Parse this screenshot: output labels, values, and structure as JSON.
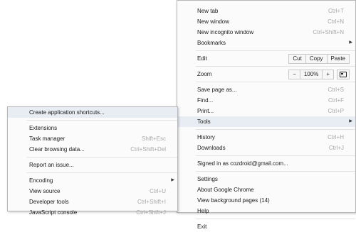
{
  "main_menu": {
    "new_tab": {
      "label": "New tab",
      "shortcut": "Ctrl+T"
    },
    "new_window": {
      "label": "New window",
      "shortcut": "Ctrl+N"
    },
    "new_incognito": {
      "label": "New incognito window",
      "shortcut": "Ctrl+Shift+N"
    },
    "bookmarks": {
      "label": "Bookmarks"
    },
    "edit": {
      "label": "Edit",
      "cut": "Cut",
      "copy": "Copy",
      "paste": "Paste"
    },
    "zoom": {
      "label": "Zoom",
      "minus": "−",
      "level": "100%",
      "plus": "+"
    },
    "save_page": {
      "label": "Save page as...",
      "shortcut": "Ctrl+S"
    },
    "find": {
      "label": "Find...",
      "shortcut": "Ctrl+F"
    },
    "print": {
      "label": "Print...",
      "shortcut": "Ctrl+P"
    },
    "tools": {
      "label": "Tools"
    },
    "history": {
      "label": "History",
      "shortcut": "Ctrl+H"
    },
    "downloads": {
      "label": "Downloads",
      "shortcut": "Ctrl+J"
    },
    "signed_in": {
      "label": "Signed in as cozdroid@gmail.com..."
    },
    "settings": {
      "label": "Settings"
    },
    "about": {
      "label": "About Google Chrome"
    },
    "background_pages": {
      "label": "View background pages (14)"
    },
    "help": {
      "label": "Help"
    },
    "exit": {
      "label": "Exit"
    }
  },
  "tools_menu": {
    "create_shortcuts": {
      "label": "Create application shortcuts..."
    },
    "extensions": {
      "label": "Extensions"
    },
    "task_manager": {
      "label": "Task manager",
      "shortcut": "Shift+Esc"
    },
    "clear_browsing": {
      "label": "Clear browsing data...",
      "shortcut": "Ctrl+Shift+Del"
    },
    "report_issue": {
      "label": "Report an issue..."
    },
    "encoding": {
      "label": "Encoding"
    },
    "view_source": {
      "label": "View source",
      "shortcut": "Ctrl+U"
    },
    "developer_tools": {
      "label": "Developer tools",
      "shortcut": "Ctrl+Shift+I"
    },
    "js_console": {
      "label": "JavaScript console",
      "shortcut": "Ctrl+Shift+J"
    }
  },
  "icons": {
    "submenu_arrow": "right-triangle",
    "fullscreen": "fullscreen-icon"
  }
}
